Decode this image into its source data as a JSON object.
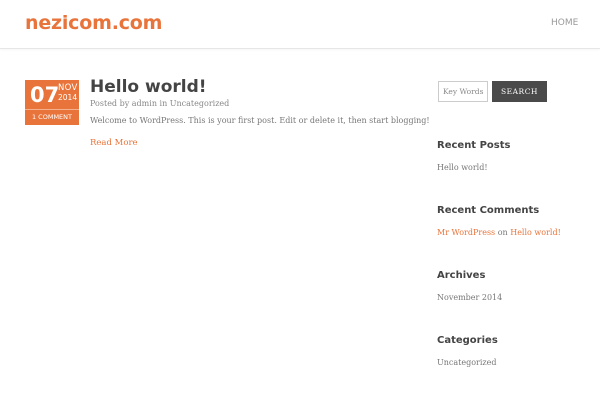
{
  "header": {
    "site_title": "nezicom.com",
    "nav_home": "HOME"
  },
  "post": {
    "day": "07",
    "month": "NOV",
    "year": "2014",
    "comments": "1 COMMENT",
    "title": "Hello world!",
    "meta_prefix": "Posted by",
    "author": "admin",
    "meta_in": "in",
    "category": "Uncategorized",
    "excerpt": "Welcome to WordPress. This is your first post. Edit or delete it, then start blogging!",
    "read_more": "Read More"
  },
  "sidebar": {
    "search": {
      "placeholder": "Key Words",
      "button": "SEARCH"
    },
    "recent_posts": {
      "title": "Recent Posts",
      "items": [
        "Hello world!"
      ]
    },
    "recent_comments": {
      "title": "Recent Comments",
      "author": "Mr WordPress",
      "on": "on",
      "post": "Hello world!"
    },
    "archives": {
      "title": "Archives",
      "items": [
        "November 2014"
      ]
    },
    "categories": {
      "title": "Categories",
      "items": [
        "Uncategorized"
      ]
    }
  },
  "colors": {
    "accent": "#e8743b",
    "button_dark": "#4a4a4a"
  }
}
